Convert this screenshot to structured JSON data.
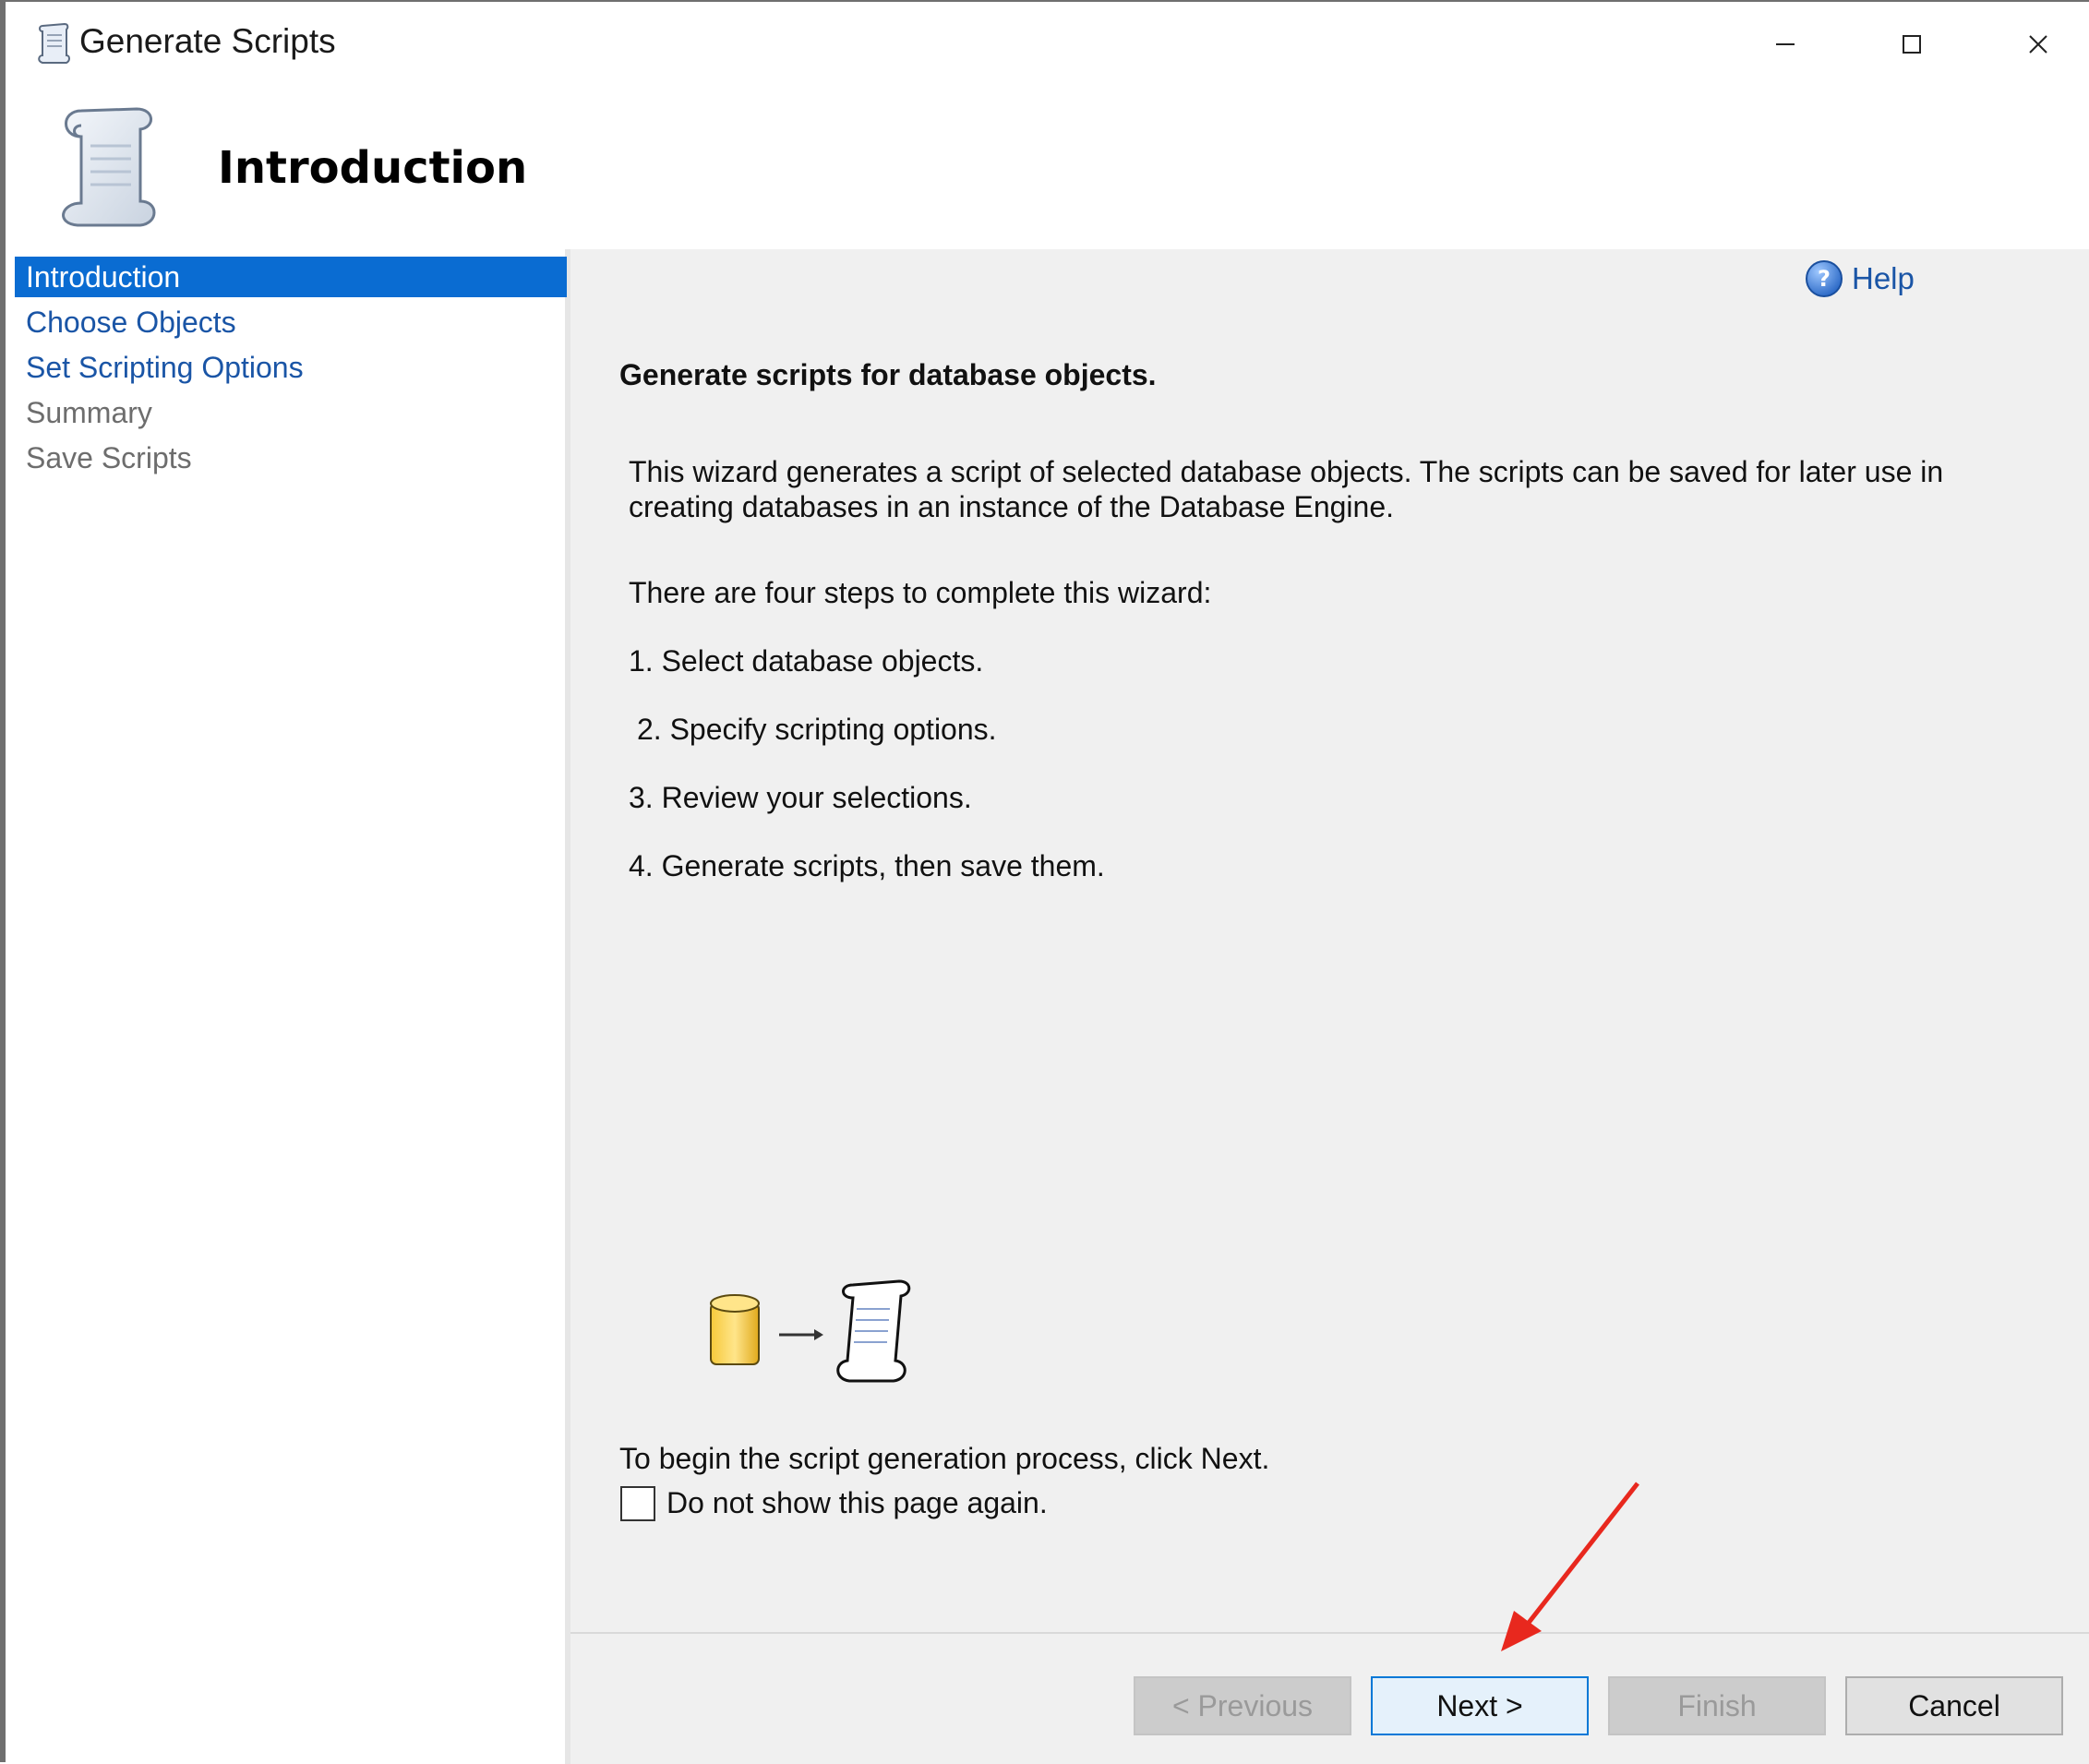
{
  "window": {
    "title": "Generate Scripts",
    "controls": {
      "minimize": "—",
      "maximize": "☐",
      "close": "✕"
    }
  },
  "header": {
    "title": "Introduction"
  },
  "nav": {
    "items": [
      {
        "label": "Introduction",
        "state": "active"
      },
      {
        "label": "Choose Objects",
        "state": "link"
      },
      {
        "label": "Set Scripting Options",
        "state": "link"
      },
      {
        "label": "Summary",
        "state": "disabled"
      },
      {
        "label": "Save Scripts",
        "state": "disabled"
      }
    ]
  },
  "main": {
    "help_label": "Help",
    "heading": "Generate scripts for database objects.",
    "description": "This wizard generates a script of selected database objects. The scripts can be saved for later use in creating databases in an instance of the Database Engine.",
    "steps_intro": "There are four steps to complete this wizard:",
    "steps": [
      "1. Select database objects.",
      "2. Specify scripting options.",
      "3. Review your selections.",
      "4. Generate scripts, then save them."
    ],
    "begin_text": "To begin the script generation process, click Next.",
    "checkbox": {
      "label": "Do not show this page again.",
      "checked": false
    }
  },
  "buttons": {
    "previous": "< Previous",
    "next": "Next >",
    "finish": "Finish",
    "cancel": "Cancel"
  },
  "colors": {
    "nav_active_bg": "#0a6cd2",
    "link": "#1a55a6",
    "annotation_arrow": "#e8281e",
    "primary_button_border": "#0078d7"
  },
  "icons": [
    "script-scroll-icon",
    "help-icon",
    "database-icon",
    "arrow-right-icon"
  ]
}
